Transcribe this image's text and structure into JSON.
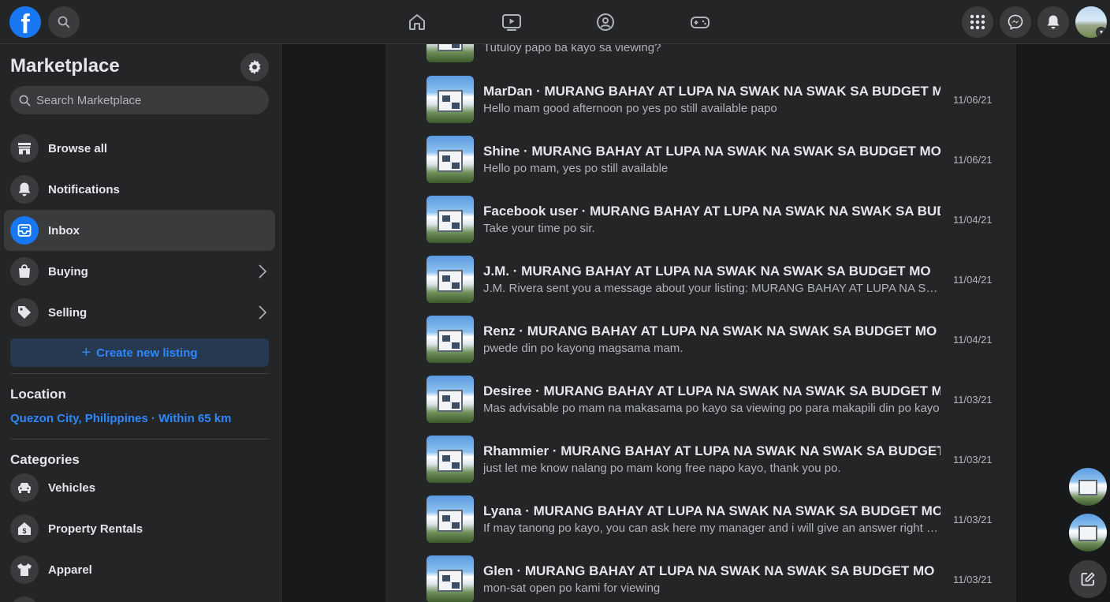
{
  "topbar": {
    "logo": "f",
    "icons": [
      "search-icon",
      "home-icon",
      "watch-icon",
      "groups-icon",
      "gaming-icon",
      "menu-grid-icon",
      "messenger-icon",
      "notifications-icon",
      "account-avatar"
    ]
  },
  "sidebar": {
    "title": "Marketplace",
    "search_placeholder": "Search Marketplace",
    "items": [
      {
        "label": "Browse all",
        "icon": "storefront-icon"
      },
      {
        "label": "Notifications",
        "icon": "bell-icon"
      },
      {
        "label": "Inbox",
        "icon": "inbox-icon",
        "active": true
      },
      {
        "label": "Buying",
        "icon": "shopping-bag-icon"
      },
      {
        "label": "Selling",
        "icon": "tag-icon"
      }
    ],
    "create_label": "Create new listing",
    "location_title": "Location",
    "location_value": "Quezon City, Philippines · Within 65 km",
    "categories_title": "Categories",
    "categories": [
      {
        "label": "Vehicles",
        "icon": "car-icon"
      },
      {
        "label": "Property Rentals",
        "icon": "house-dollar-icon"
      },
      {
        "label": "Apparel",
        "icon": "shirt-icon"
      }
    ]
  },
  "inbox": {
    "partial_top_msg": "Tutuloy papo ba kayo sa viewing?",
    "threads": [
      {
        "title": "MarDan · MURANG BAHAY AT LUPA NA SWAK NA SWAK SA BUDGET MO",
        "message": "Hello mam good afternoon po yes po still available papo",
        "date": "11/06/21"
      },
      {
        "title": "Shine · MURANG BAHAY AT LUPA NA SWAK NA SWAK SA BUDGET MO",
        "message": "Hello po mam, yes po still available",
        "date": "11/06/21"
      },
      {
        "title": "Facebook user · MURANG BAHAY AT LUPA NA SWAK NA SWAK SA BUDGET MO",
        "message": "Take your time po sir.",
        "date": "11/04/21"
      },
      {
        "title": "J.M. · MURANG BAHAY AT LUPA NA SWAK NA SWAK SA BUDGET MO",
        "message": "J.M. Rivera sent you a message about your listing: MURANG BAHAY AT LUPA NA SWAK NA SWAK SA BUDGET MO",
        "date": "11/04/21"
      },
      {
        "title": "Renz · MURANG BAHAY AT LUPA NA SWAK NA SWAK SA BUDGET MO",
        "message": "pwede din po kayong magsama mam.",
        "date": "11/04/21"
      },
      {
        "title": "Desiree · MURANG BAHAY AT LUPA NA SWAK NA SWAK SA BUDGET MO",
        "message": "Mas advisable po mam na makasama po kayo sa viewing po para makapili din po kayo",
        "date": "11/03/21"
      },
      {
        "title": "Rhammier · MURANG BAHAY AT LUPA NA SWAK NA SWAK SA BUDGET MO",
        "message": "just let me know nalang po mam kong free napo kayo, thank you po.",
        "date": "11/03/21"
      },
      {
        "title": "Lyana · MURANG BAHAY AT LUPA NA SWAK NA SWAK SA BUDGET MO",
        "message": "If may tanong po kayo, you can ask here my manager and i will give an answer right away",
        "date": "11/03/21"
      },
      {
        "title": "Glen · MURANG BAHAY AT LUPA NA SWAK NA SWAK SA BUDGET MO",
        "message": "mon-sat open po kami for viewing",
        "date": "11/03/21"
      }
    ]
  },
  "colors": {
    "accent": "#1877f2",
    "link": "#2d88ff",
    "surface": "#242526",
    "background": "#18191a"
  }
}
